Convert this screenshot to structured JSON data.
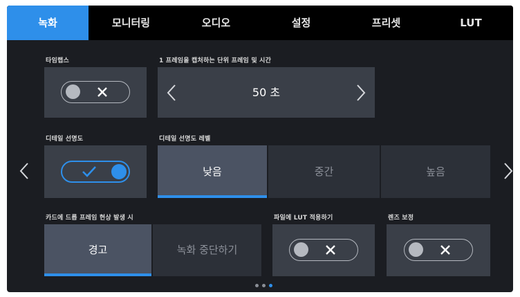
{
  "tabs": [
    "녹화",
    "모니터링",
    "오디오",
    "설정",
    "프리셋",
    "LUT"
  ],
  "active_tab": "녹화",
  "timelapse": {
    "label": "타임랩스",
    "state": "off"
  },
  "frames": {
    "label": "1 프레임을 캡처하는 단위 프레임 및 시간",
    "value": "50 초"
  },
  "detail": {
    "label": "디테일 선명도",
    "state": "on"
  },
  "detail_level": {
    "label": "디테일 선명도 레벨",
    "options": [
      "낮음",
      "중간",
      "높음"
    ],
    "selected": "낮음"
  },
  "dropped_frames": {
    "label": "카드에 드롭 프레임 현상 발생 시",
    "options": [
      "경고",
      "녹화 중단하기"
    ],
    "selected": "경고"
  },
  "apply_lut": {
    "label": "파일에 LUT 적용하기",
    "state": "off"
  },
  "lens_correction": {
    "label": "렌즈 보정",
    "state": "off"
  },
  "pagination": {
    "pages": 3,
    "current": 3
  },
  "colors": {
    "accent": "#2e8fea",
    "background": "#1b1d22",
    "tab_bar": "#000000"
  }
}
